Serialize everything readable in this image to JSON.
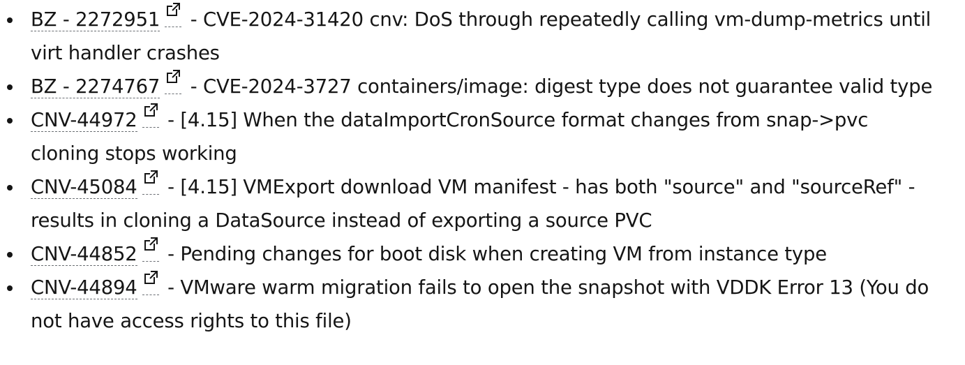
{
  "items": [
    {
      "id": "BZ - 2272951",
      "link_icon": "external-link-icon",
      "text": " - CVE-2024-31420 cnv: DoS through repeatedly calling vm-dump-metrics until virt handler crashes"
    },
    {
      "id": "BZ - 2274767",
      "link_icon": "external-link-icon",
      "text": " - CVE-2024-3727 containers/image: digest type does not guarantee valid type"
    },
    {
      "id": "CNV-44972",
      "link_icon": "external-link-icon",
      "text": " - [4.15] When the dataImportCronSource format changes from snap->pvc cloning stops working"
    },
    {
      "id": "CNV-45084",
      "link_icon": "external-link-icon",
      "text": " - [4.15] VMExport download VM manifest - has both \"source\" and \"sourceRef\" - results in cloning a DataSource instead of exporting a source PVC"
    },
    {
      "id": "CNV-44852",
      "link_icon": "external-link-icon",
      "text": " - Pending changes for boot disk when creating VM from instance type"
    },
    {
      "id": "CNV-44894",
      "link_icon": "external-link-icon",
      "text": " - VMware warm migration fails to open the snapshot with VDDK Error 13 (You do not have access rights to this file)"
    }
  ]
}
